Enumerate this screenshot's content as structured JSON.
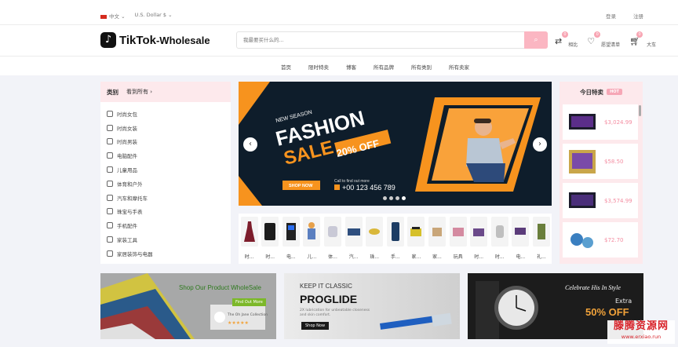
{
  "topbar": {
    "language": "中文",
    "currency": "U.S. Dollar $",
    "login": "登录",
    "register": "注册"
  },
  "header": {
    "logo_text": "TikTok",
    "logo_suffix": "-Wholesale",
    "search_placeholder": "我最要买什么的...",
    "compare": {
      "count": "0",
      "label": "相比"
    },
    "wishlist": {
      "count": "0",
      "label": "愿望清单"
    },
    "cart": {
      "count": "0",
      "label": "大车"
    }
  },
  "nav": [
    "首页",
    "限时特卖",
    "博客",
    "所有品牌",
    "所有类别",
    "所有卖家"
  ],
  "categories": {
    "title": "类别",
    "see_all": "看到所有 ›",
    "items": [
      "时尚女包",
      "时尚女装",
      "时尚男装",
      "电脑配件",
      "儿童用品",
      "体育和户外",
      "汽车和摩托车",
      "珠宝与手表",
      "手机配件",
      "家装工具",
      "家居装饰与电器"
    ]
  },
  "banner": {
    "kicker": "NEW SEASON",
    "headline1": "FASHION",
    "headline2": "SALE",
    "offer": "20% OFF",
    "cta": "SHOP NOW",
    "call_label": "Call to find out more",
    "phone": "+00 123 456 789",
    "slide_total": 4,
    "slide_active": 3
  },
  "thumbs": [
    "时...",
    "时...",
    "电...",
    "儿...",
    "体...",
    "汽...",
    "珠...",
    "手...",
    "家...",
    "家...",
    "玩具",
    "时...",
    "时...",
    "电...",
    "礼..."
  ],
  "deals": {
    "title": "今日特卖",
    "hot": "HOT",
    "prices": [
      "$3,024.99",
      "$58.50",
      "$3,574.99",
      "$72.70"
    ]
  },
  "promos": {
    "p1": {
      "title": "Shop Our Product WholeSale",
      "cta": "Find Out More",
      "caption": "The Oh Jane Collection"
    },
    "p2": {
      "kicker": "KEEP IT CLASSIC",
      "title": "PROGLIDE",
      "sub": "2X lubrication for unbeatable closeness and skin comfort.",
      "cta": "Shop Now"
    },
    "p3": {
      "title": "Celebrate His In Style",
      "extra": "Extra",
      "offer": "50% OFF"
    }
  },
  "watermark": {
    "line1": "滕腾资源网",
    "line2": "www.erxiao.run"
  },
  "colors": {
    "accent": "#fbb6c2",
    "price": "#f48ea2",
    "banner_orange": "#f7931e",
    "banner_dark": "#0e1d2b"
  }
}
